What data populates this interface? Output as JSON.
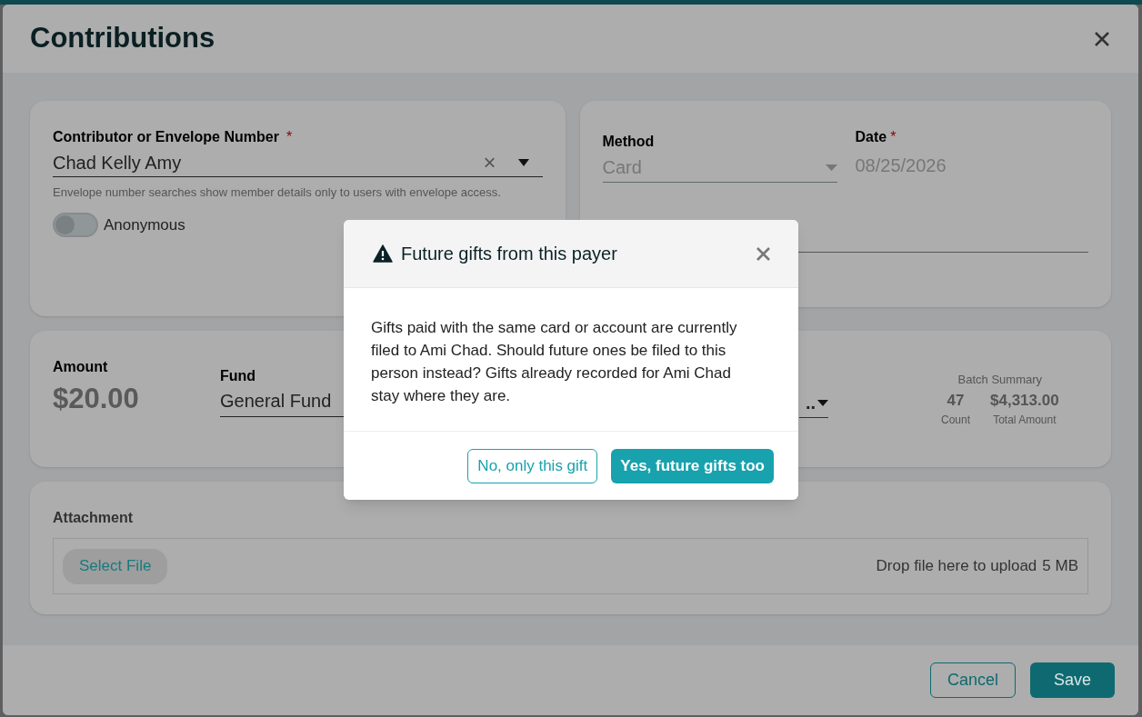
{
  "modal": {
    "title": "Contributions",
    "contributor": {
      "label": "Contributor or Envelope Number",
      "required_mark": "*",
      "value": "Chad Kelly Amy",
      "clear": "×",
      "help": "Envelope number searches show member details only to users with envelope access."
    },
    "anonymous": {
      "label": "Anonymous",
      "on": false
    },
    "method": {
      "label": "Method",
      "value": "Card",
      "disabled": true
    },
    "date": {
      "label": "Date",
      "required_mark": "*",
      "value": "08/25/2026",
      "disabled": true
    },
    "amount": {
      "label": "Amount",
      "value": "$20.00"
    },
    "fund": {
      "label": "Fund",
      "value": "General Fund"
    },
    "field_3": {
      "value": ".."
    },
    "batch_summary": {
      "title": "Batch Summary",
      "stats": [
        {
          "value": "47",
          "label": "Count"
        },
        {
          "value": "$4,313.00",
          "label": "Total Amount"
        }
      ]
    },
    "attachment": {
      "label": "Attachment",
      "button": "Select File",
      "drop_text": "Drop file here to upload",
      "limit": "5 MB"
    },
    "buttons": [
      {
        "label": "Cancel",
        "kind": "secondary"
      },
      {
        "label": "Save",
        "kind": "primary"
      }
    ]
  },
  "dialog": {
    "title": "Future gifts from this payer",
    "message": "Gifts paid with the same card or account are currently filed to Ami Chad. Should future ones be filed to this person instead? Gifts already recorded for Ami Chad stay where they are.",
    "buttons": [
      {
        "label": "No, only this gift",
        "kind": "secondary"
      },
      {
        "label": "Yes, future gifts too",
        "kind": "primary"
      }
    ]
  }
}
